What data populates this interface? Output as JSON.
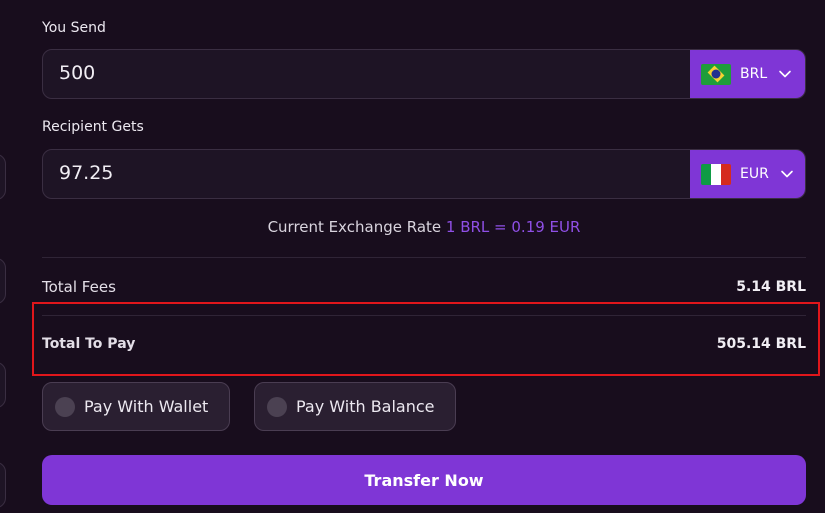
{
  "send": {
    "label": "You Send",
    "amount": "500",
    "currency": "BRL",
    "flag_icon": "brazil-flag-icon"
  },
  "receive": {
    "label": "Recipient Gets",
    "amount": "97.25",
    "currency": "EUR",
    "flag_icon": "italy-flag-icon"
  },
  "exchange_rate": {
    "prefix": "Current Exchange Rate",
    "value": "1 BRL = 0.19 EUR"
  },
  "summary": {
    "fees_label": "Total Fees",
    "fees_value": "5.14 BRL",
    "total_label": "Total To Pay",
    "total_value": "505.14 BRL"
  },
  "payment_options": [
    {
      "label": "Pay With Wallet"
    },
    {
      "label": "Pay With Balance"
    }
  ],
  "transfer_button": "Transfer Now",
  "colors": {
    "accent": "#7f36d6",
    "background": "#180d1d",
    "highlight_box": "#e0161b",
    "rate_highlight": "#8f4fe6"
  }
}
